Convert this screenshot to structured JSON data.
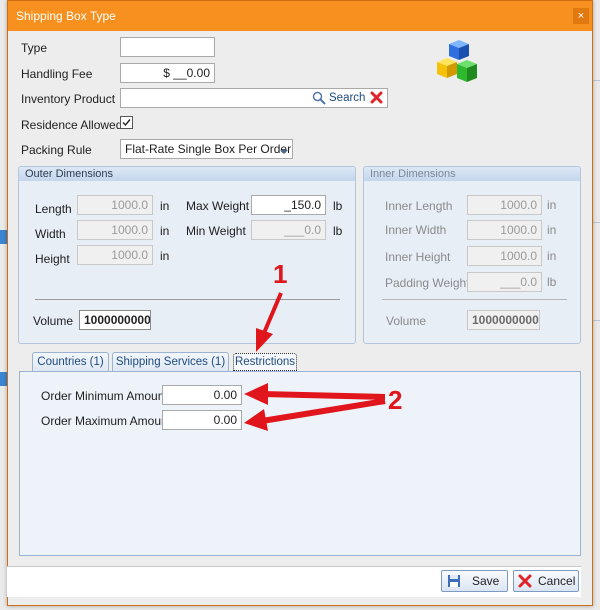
{
  "window": {
    "title": "Shipping Box Type",
    "close_glyph": "×"
  },
  "form": {
    "type_label": "Type",
    "type_value": "",
    "handling_fee_label": "Handling Fee",
    "handling_fee_value": "$ __0.00",
    "inventory_product_label": "Inventory Product",
    "inventory_product_value": "",
    "search_label": "Search",
    "residence_allowed_label": "Residence Allowed",
    "residence_allowed_checked": true,
    "packing_rule_label": "Packing Rule",
    "packing_rule_value": "Flat-Rate Single Box Per Order"
  },
  "outer": {
    "title": "Outer Dimensions",
    "length_label": "Length",
    "length_value": "1000.0",
    "length_unit": "in",
    "width_label": "Width",
    "width_value": "1000.0",
    "width_unit": "in",
    "height_label": "Height",
    "height_value": "1000.0",
    "height_unit": "in",
    "max_weight_label": "Max Weight",
    "max_weight_value": "_150.0",
    "max_weight_unit": "lb",
    "min_weight_label": "Min Weight",
    "min_weight_value": "___0.0",
    "min_weight_unit": "lb",
    "volume_label": "Volume",
    "volume_value": "1000000000"
  },
  "inner": {
    "title": "Inner Dimensions",
    "length_label": "Inner Length",
    "length_value": "1000.0",
    "length_unit": "in",
    "width_label": "Inner Width",
    "width_value": "1000.0",
    "width_unit": "in",
    "height_label": "Inner Height",
    "height_value": "1000.0",
    "height_unit": "in",
    "padding_label": "Padding Weight",
    "padding_value": "___0.0",
    "padding_unit": "lb",
    "volume_label": "Volume",
    "volume_value": "1000000000"
  },
  "tabs": [
    {
      "label": "Countries (1)"
    },
    {
      "label": "Shipping Services (1)"
    },
    {
      "label": "Restrictions"
    }
  ],
  "restrictions": {
    "min_label": "Order Minimum Amount",
    "min_value": "0.00",
    "max_label": "Order Maximum Amount",
    "max_value": "0.00"
  },
  "annotations": {
    "marker1": "1",
    "marker2": "2",
    "color": "#e0161c"
  },
  "buttons": {
    "save": "Save",
    "cancel": "Cancel"
  },
  "colors": {
    "titlebar": "#f7901e",
    "group_bg": "#e7eef6",
    "accent": "#1f4a7f"
  }
}
